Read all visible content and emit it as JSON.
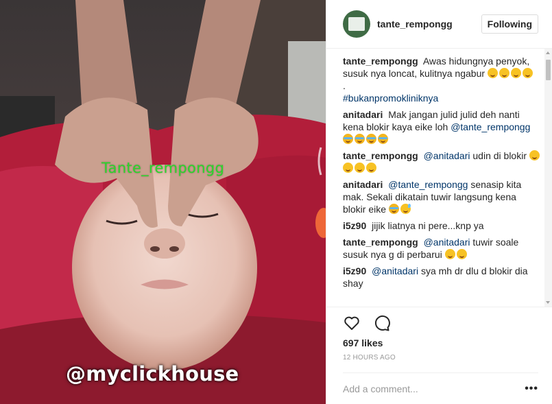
{
  "media": {
    "overlay_text": "Tante_rempongg",
    "watermark": "@myclickhouse"
  },
  "header": {
    "username": "tante_rempongg",
    "follow_label": "Following"
  },
  "caption": {
    "user": "tante_rempongg",
    "text": "Awas hidungnya penyok, susuk nya loncat, kulitnya ngabur",
    "dot": ".",
    "hashtag": "#bukanpromokliniknya"
  },
  "comments": [
    {
      "user": "anitadari",
      "text": "Mak jangan julid julid deh nanti kena blokir kaya eike loh",
      "mention": "@tante_rempongg"
    },
    {
      "user": "tante_rempongg",
      "mention": "@anitadari",
      "text": "udin di blokir"
    },
    {
      "user": "anitadari",
      "mention": "@tante_rempongg",
      "text": "senasip kita mak. Sekali dikatain tuwir langsung kena blokir eike"
    },
    {
      "user": "i5z90",
      "text": "jijik liatnya ni pere...knp ya"
    },
    {
      "user": "tante_rempongg",
      "mention": "@anitadari",
      "text": "tuwir soale susuk nya g di perbarui"
    },
    {
      "user": "i5z90",
      "mention": "@anitadari",
      "text": "sya mh dr dlu d blokir dia shay"
    }
  ],
  "actions": {
    "likes": "697 likes",
    "timestamp": "12 HOURS AGO"
  },
  "add_comment": {
    "placeholder": "Add a comment...",
    "more": "•••"
  },
  "icons": [
    "heart-icon",
    "comment-icon",
    "more-options-icon"
  ],
  "colors": {
    "link": "#003569",
    "muted": "#999999",
    "border": "#efefef",
    "overlay_green": "#2bd62b"
  }
}
